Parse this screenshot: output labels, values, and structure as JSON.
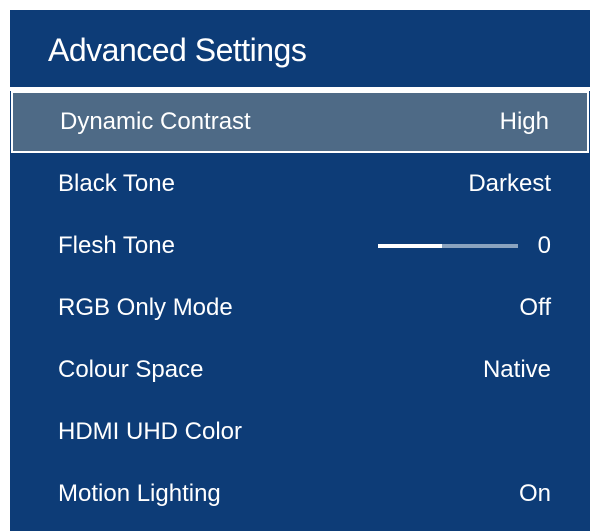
{
  "panel": {
    "title": "Advanced Settings"
  },
  "settings": [
    {
      "label": "Dynamic Contrast",
      "value": "High",
      "selected": true
    },
    {
      "label": "Black Tone",
      "value": "Darkest"
    },
    {
      "label": "Flesh Tone",
      "value": "0",
      "slider_fraction": 0.46
    },
    {
      "label": "RGB Only Mode",
      "value": "Off"
    },
    {
      "label": "Colour Space",
      "value": "Native"
    },
    {
      "label": "HDMI UHD Color",
      "value": ""
    },
    {
      "label": "Motion Lighting",
      "value": "On"
    }
  ],
  "colors": {
    "panel_background": "#0d3c77",
    "selected_row_background": "#4e6a86",
    "text": "#ffffff"
  }
}
